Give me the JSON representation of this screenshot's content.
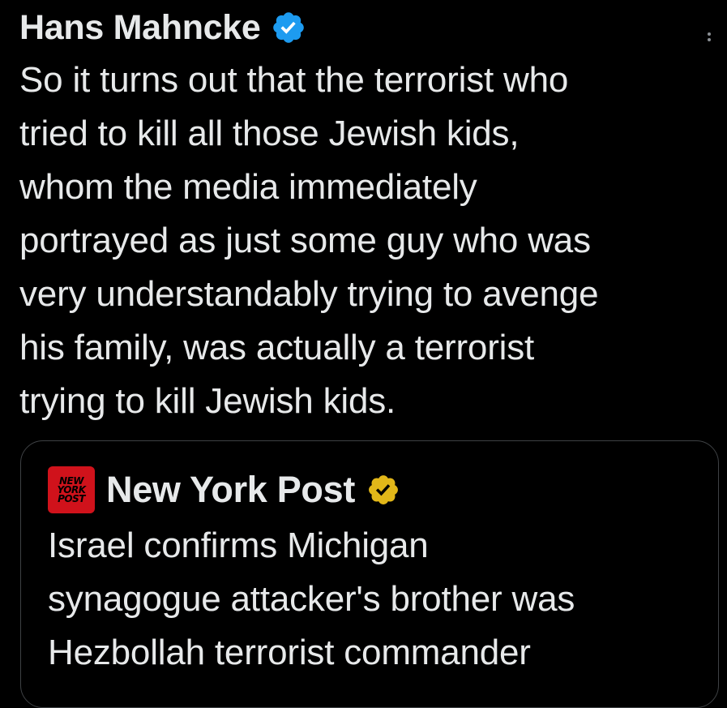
{
  "tweet": {
    "author_name": "Hans Mahncke",
    "verified_icon": "blue-verified-badge-icon",
    "more_icon": "more-options-icon",
    "text": "So it turns out that the terrorist who\ntried to kill all those Jewish kids,\nwhom the media immediately\nportrayed as just some guy who was\nvery understandably trying to avenge\nhis family, was actually a terrorist\ntrying to kill Jewish kids."
  },
  "quoted_tweet": {
    "avatar_logo_lines": [
      "NEW",
      "YORK",
      "POST"
    ],
    "author_name": "New York Post",
    "verified_icon": "gold-verified-badge-icon",
    "text": "Israel confirms Michigan\nsynagogue attacker's brother was\nHezbollah terrorist commander"
  },
  "colors": {
    "background": "#000000",
    "text": "#e7e9ea",
    "blue_verified": "#1d9bf0",
    "gold_verified": "#e2b719",
    "nyp_red": "#d0121b",
    "card_border": "#3e4144"
  }
}
